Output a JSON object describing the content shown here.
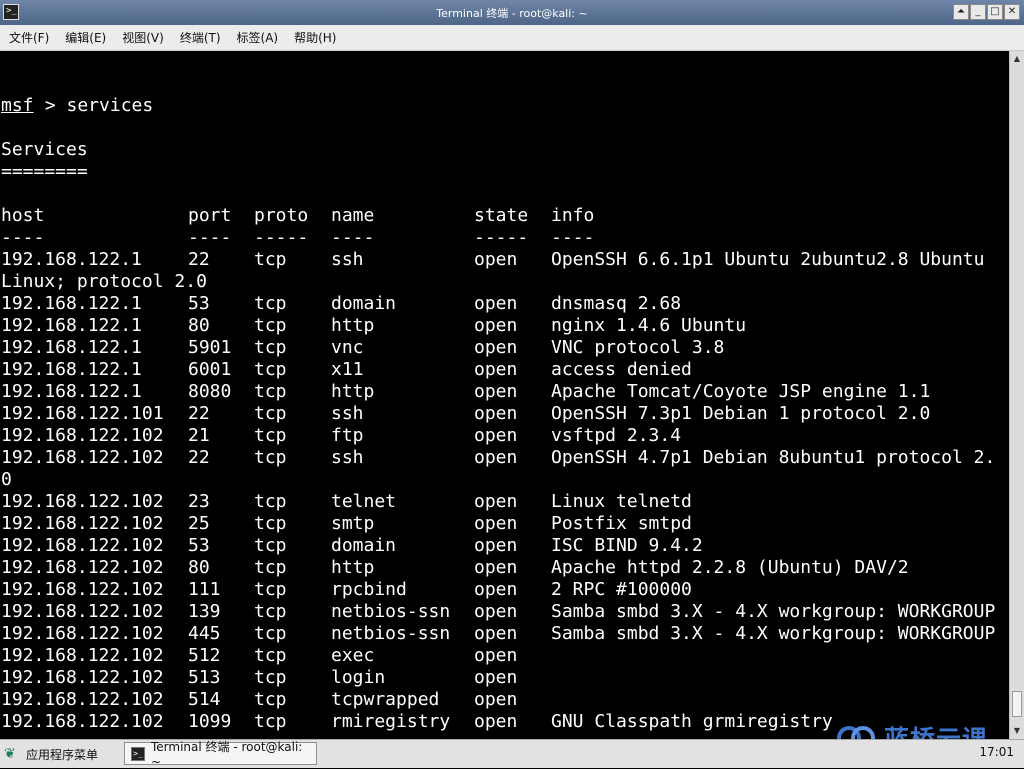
{
  "window": {
    "title": "Terminal 终端 - root@kali: ~",
    "app_icon": "terminal-icon",
    "controls": [
      "shade-icon",
      "minimize-icon",
      "maximize-icon",
      "close-icon"
    ]
  },
  "menu": [
    {
      "label": "文件(F)",
      "name": "menu-file"
    },
    {
      "label": "编辑(E)",
      "name": "menu-edit"
    },
    {
      "label": "视图(V)",
      "name": "menu-view"
    },
    {
      "label": "终端(T)",
      "name": "menu-terminal"
    },
    {
      "label": "标签(A)",
      "name": "menu-tabs"
    },
    {
      "label": "帮助(H)",
      "name": "menu-help"
    }
  ],
  "terminal": {
    "prompt": "msf",
    "command": " > services",
    "heading": "Services",
    "heading_rule": "========",
    "headers": [
      "host",
      "port",
      "proto",
      "name",
      "state",
      "info"
    ],
    "header_rules": [
      "----",
      "----",
      "-----",
      "----",
      "-----",
      "----"
    ],
    "rows": [
      {
        "host": "192.168.122.1",
        "port": "22",
        "proto": "tcp",
        "name": "ssh",
        "state": "open",
        "info": "OpenSSH 6.6.1p1 Ubuntu 2ubuntu2.8 Ubuntu",
        "wrap": "Linux; protocol 2.0"
      },
      {
        "host": "192.168.122.1",
        "port": "53",
        "proto": "tcp",
        "name": "domain",
        "state": "open",
        "info": "dnsmasq 2.68"
      },
      {
        "host": "192.168.122.1",
        "port": "80",
        "proto": "tcp",
        "name": "http",
        "state": "open",
        "info": "nginx 1.4.6 Ubuntu"
      },
      {
        "host": "192.168.122.1",
        "port": "5901",
        "proto": "tcp",
        "name": "vnc",
        "state": "open",
        "info": "VNC protocol 3.8"
      },
      {
        "host": "192.168.122.1",
        "port": "6001",
        "proto": "tcp",
        "name": "x11",
        "state": "open",
        "info": "access denied"
      },
      {
        "host": "192.168.122.1",
        "port": "8080",
        "proto": "tcp",
        "name": "http",
        "state": "open",
        "info": "Apache Tomcat/Coyote JSP engine 1.1"
      },
      {
        "host": "192.168.122.101",
        "port": "22",
        "proto": "tcp",
        "name": "ssh",
        "state": "open",
        "info": "OpenSSH 7.3p1 Debian 1 protocol 2.0"
      },
      {
        "host": "192.168.122.102",
        "port": "21",
        "proto": "tcp",
        "name": "ftp",
        "state": "open",
        "info": "vsftpd 2.3.4"
      },
      {
        "host": "192.168.122.102",
        "port": "22",
        "proto": "tcp",
        "name": "ssh",
        "state": "open",
        "info": "OpenSSH 4.7p1 Debian 8ubuntu1 protocol 2.",
        "wrap": "0"
      },
      {
        "host": "192.168.122.102",
        "port": "23",
        "proto": "tcp",
        "name": "telnet",
        "state": "open",
        "info": "Linux telnetd"
      },
      {
        "host": "192.168.122.102",
        "port": "25",
        "proto": "tcp",
        "name": "smtp",
        "state": "open",
        "info": "Postfix smtpd"
      },
      {
        "host": "192.168.122.102",
        "port": "53",
        "proto": "tcp",
        "name": "domain",
        "state": "open",
        "info": "ISC BIND 9.4.2"
      },
      {
        "host": "192.168.122.102",
        "port": "80",
        "proto": "tcp",
        "name": "http",
        "state": "open",
        "info": "Apache httpd 2.2.8 (Ubuntu) DAV/2"
      },
      {
        "host": "192.168.122.102",
        "port": "111",
        "proto": "tcp",
        "name": "rpcbind",
        "state": "open",
        "info": "2 RPC #100000"
      },
      {
        "host": "192.168.122.102",
        "port": "139",
        "proto": "tcp",
        "name": "netbios-ssn",
        "state": "open",
        "info": "Samba smbd 3.X - 4.X workgroup: WORKGROUP"
      },
      {
        "host": "192.168.122.102",
        "port": "445",
        "proto": "tcp",
        "name": "netbios-ssn",
        "state": "open",
        "info": "Samba smbd 3.X - 4.X workgroup: WORKGROUP"
      },
      {
        "host": "192.168.122.102",
        "port": "512",
        "proto": "tcp",
        "name": "exec",
        "state": "open",
        "info": ""
      },
      {
        "host": "192.168.122.102",
        "port": "513",
        "proto": "tcp",
        "name": "login",
        "state": "open",
        "info": ""
      },
      {
        "host": "192.168.122.102",
        "port": "514",
        "proto": "tcp",
        "name": "tcpwrapped",
        "state": "open",
        "info": ""
      },
      {
        "host": "192.168.122.102",
        "port": "1099",
        "proto": "tcp",
        "name": "rmiregistry",
        "state": "open",
        "info": "GNU Classpath grmiregistry"
      }
    ]
  },
  "taskbar": {
    "start_label": "应用程序菜单",
    "start_icon": "kali-dragon-icon",
    "task_label": "Terminal 终端 - root@kali: ~",
    "task_icon": "terminal-icon",
    "clock": "17:01"
  },
  "watermark": {
    "text": "蓝桥云课",
    "icon": "lanqiao-logo-icon",
    "color": "#3d74c9"
  }
}
